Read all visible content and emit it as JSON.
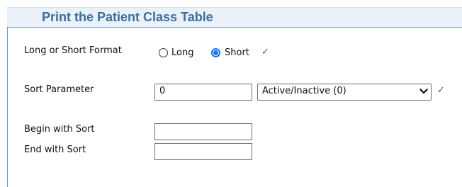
{
  "title": "Print the Patient Class Table",
  "format": {
    "label": "Long or Short Format",
    "options": [
      "Long",
      "Short"
    ],
    "selected": "Short",
    "check": "✓"
  },
  "sort": {
    "label": "Sort Parameter",
    "value": "0",
    "select_value": "Active/Inactive (0)",
    "check": "✓"
  },
  "begin_sort": {
    "label": "Begin with Sort",
    "value": ""
  },
  "end_sort": {
    "label": "End with Sort",
    "value": ""
  },
  "colors": {
    "title": "#3c6e9c",
    "radio_accent": "#1a73e8",
    "border_rule": "#6c9bc8"
  },
  "icons": {
    "dropdown": "chevron-down-icon",
    "check": "checkmark-icon"
  }
}
